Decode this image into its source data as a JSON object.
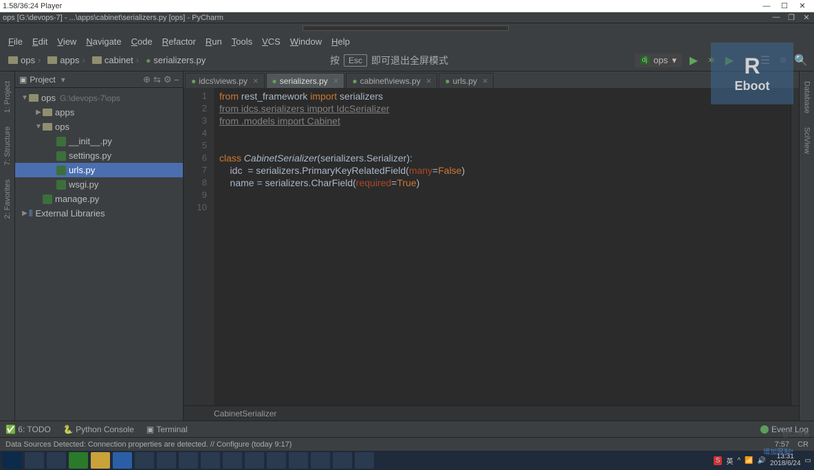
{
  "player": {
    "title": "1.58/36:24 Player"
  },
  "window": {
    "title": "ops [G:\\devops-7] - ...\\apps\\cabinet\\serializers.py [ops] - PyCharm"
  },
  "menu": [
    "File",
    "Edit",
    "View",
    "Navigate",
    "Code",
    "Refactor",
    "Run",
    "Tools",
    "VCS",
    "Window",
    "Help"
  ],
  "crumbs": [
    "ops",
    "apps",
    "cabinet",
    "serializers.py"
  ],
  "overlay": {
    "prefix": "按",
    "key": "Esc",
    "suffix": "即可退出全屏模式"
  },
  "run_config": {
    "prefix": "dj",
    "name": "ops"
  },
  "reboot": {
    "big": "R",
    "small": "Eboot"
  },
  "left_tabs": [
    "1: Project",
    "7: Structure",
    "2: Favorites"
  ],
  "right_tabs": [
    "Database",
    "SciView"
  ],
  "project": {
    "title": "Project",
    "tree": [
      {
        "indent": 0,
        "arrow": "▼",
        "icon": "folder",
        "label": "ops",
        "hint": "G:\\devops-7\\ops",
        "selected": false
      },
      {
        "indent": 1,
        "arrow": "▶",
        "icon": "folder",
        "label": "apps",
        "selected": false
      },
      {
        "indent": 1,
        "arrow": "▼",
        "icon": "folder",
        "label": "ops",
        "selected": false
      },
      {
        "indent": 2,
        "arrow": "",
        "icon": "py",
        "label": "__init__.py",
        "selected": false
      },
      {
        "indent": 2,
        "arrow": "",
        "icon": "py",
        "label": "settings.py",
        "selected": false
      },
      {
        "indent": 2,
        "arrow": "",
        "icon": "py",
        "label": "urls.py",
        "selected": true
      },
      {
        "indent": 2,
        "arrow": "",
        "icon": "py",
        "label": "wsgi.py",
        "selected": false
      },
      {
        "indent": 1,
        "arrow": "",
        "icon": "py",
        "label": "manage.py",
        "selected": false
      },
      {
        "indent": 0,
        "arrow": "▶",
        "icon": "lib",
        "label": "External Libraries",
        "selected": false
      }
    ]
  },
  "tabs": [
    {
      "label": "idcs\\views.py",
      "active": false
    },
    {
      "label": "serializers.py",
      "active": true
    },
    {
      "label": "cabinet\\views.py",
      "active": false
    },
    {
      "label": "urls.py",
      "active": false
    }
  ],
  "code": {
    "lines": [
      {
        "n": "1",
        "html": "<span class='kw'>from</span> rest_framework <span class='kw'>import</span> serializers"
      },
      {
        "n": "2",
        "html": "<span class='u-link'>from idcs.serializers import IdcSerializer</span>"
      },
      {
        "n": "3",
        "html": "<span class='u-link'>from .models import Cabinet</span>"
      },
      {
        "n": "4",
        "html": ""
      },
      {
        "n": "5",
        "html": ""
      },
      {
        "n": "6",
        "html": "<span class='kw'>class</span> <span class='cls-name'>CabinetSerializer</span>(serializers.Serializer):"
      },
      {
        "n": "7",
        "html": "    idc  = serializers.PrimaryKeyRelatedField(<span class='named-arg'>many</span>=<span class='bool-val'>False</span>)"
      },
      {
        "n": "8",
        "html": "    name = serializers.CharField(<span class='named-arg'>required</span>=<span class='bool-val'>True</span>)"
      },
      {
        "n": "9",
        "html": ""
      },
      {
        "n": "10",
        "html": ""
      }
    ],
    "crumb": "CabinetSerializer"
  },
  "bottom_toolbar": {
    "todo": "6: TODO",
    "console": "Python Console",
    "terminal": "Terminal",
    "event_log": "Event Log"
  },
  "status": {
    "msg": "Data Sources Detected: Connection properties are detected. // Configure (today 9:17)",
    "pos": "7:57",
    "enc": "CR"
  },
  "tray": {
    "time": "13:31",
    "date": "2018/6/24"
  },
  "incomplete": "增加限制*",
  "watermark": "@Ct博客"
}
